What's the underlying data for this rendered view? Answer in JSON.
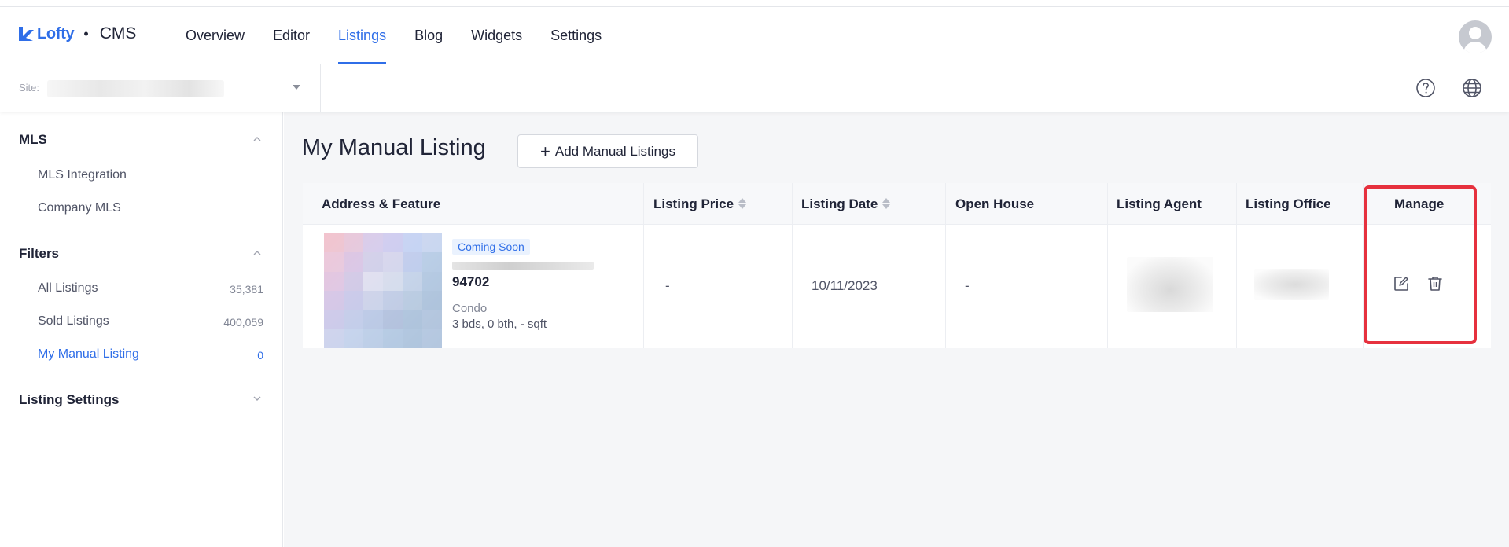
{
  "header": {
    "brand": "Lofty",
    "separator": "•",
    "product": "CMS",
    "nav": [
      {
        "label": "Overview",
        "active": false
      },
      {
        "label": "Editor",
        "active": false
      },
      {
        "label": "Listings",
        "active": true
      },
      {
        "label": "Blog",
        "active": false
      },
      {
        "label": "Widgets",
        "active": false
      },
      {
        "label": "Settings",
        "active": false
      }
    ],
    "avatar_icon": "user-avatar-icon"
  },
  "subbar": {
    "site_label": "Site:",
    "help_icon": "help-circle-icon",
    "language_icon": "globe-icon"
  },
  "sidebar": {
    "sections": [
      {
        "title": "MLS",
        "expanded": true,
        "items": [
          {
            "label": "MLS Integration",
            "count": "",
            "active": false
          },
          {
            "label": "Company MLS",
            "count": "",
            "active": false
          }
        ]
      },
      {
        "title": "Filters",
        "expanded": true,
        "items": [
          {
            "label": "All Listings",
            "count": "35,381",
            "active": false
          },
          {
            "label": "Sold Listings",
            "count": "400,059",
            "active": false
          },
          {
            "label": "My Manual Listing",
            "count": "0",
            "active": true
          }
        ]
      },
      {
        "title": "Listing Settings",
        "expanded": false,
        "items": []
      }
    ]
  },
  "main": {
    "title": "My Manual Listing",
    "add_button": {
      "icon": "+",
      "label": "Add Manual Listings"
    },
    "table": {
      "columns": [
        {
          "label": "Address & Feature",
          "sortable": false
        },
        {
          "label": "Listing Price",
          "sortable": true
        },
        {
          "label": "Listing Date",
          "sortable": true
        },
        {
          "label": "Open House",
          "sortable": false
        },
        {
          "label": "Listing Agent",
          "sortable": false
        },
        {
          "label": "Listing Office",
          "sortable": false
        },
        {
          "label": "Manage",
          "sortable": false
        }
      ],
      "rows": [
        {
          "status": "Coming Soon",
          "zip": "94702",
          "type": "Condo",
          "features": "3 bds, 0 bth, - sqft",
          "price": "-",
          "date": "10/11/2023",
          "open_house": "-",
          "manage_icons": [
            "edit-icon",
            "trash-icon"
          ]
        }
      ]
    }
  },
  "colors": {
    "accent": "#2f6ee8",
    "highlight": "#e6313e",
    "main_bg": "#f5f6f8"
  }
}
